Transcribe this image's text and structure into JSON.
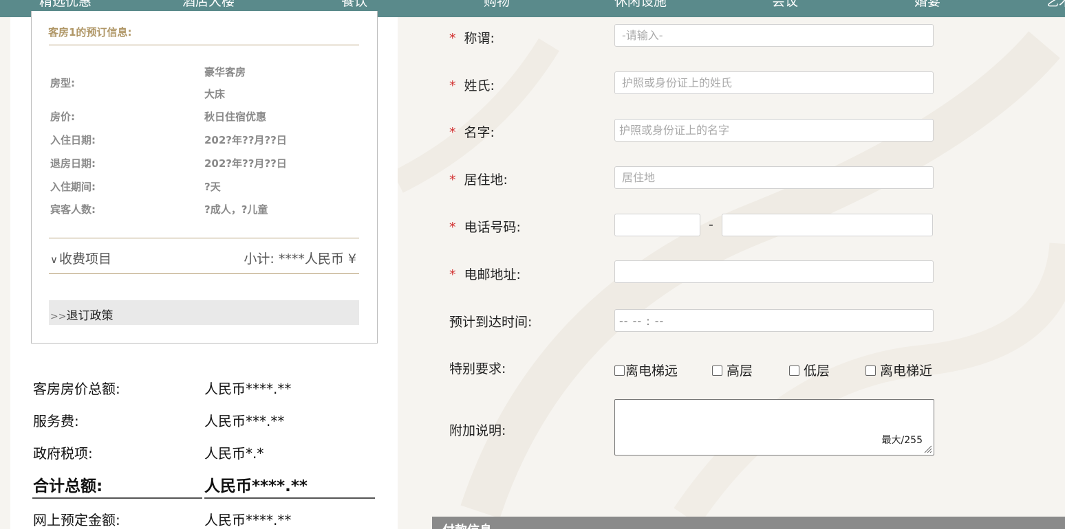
{
  "nav": {
    "items": [
      "精选优惠",
      "酒店大楼",
      "餐饮",
      "购物",
      "休闲设施",
      "会议",
      "婚宴",
      "艺术"
    ]
  },
  "booking": {
    "room_title": "客房1的预订信息:",
    "labels": {
      "room_type": "房型:",
      "room_price": "房价:",
      "checkin": "入住日期:",
      "checkout": "退房日期:",
      "stay": "入住期间:",
      "guests": "宾客人数:"
    },
    "values": {
      "room_type_1": "豪华客房",
      "room_type_2": "大床",
      "room_price": "秋日住宿优惠",
      "checkin": "202?年??月??日",
      "checkout": "202?年??月??日",
      "stay": "?天",
      "guests": "?成人，?儿童"
    },
    "fee_items": "收费项目",
    "subtotal": "小计: ****人民币 ¥",
    "policy_arrows": ">>",
    "policy": "退订政策"
  },
  "summary": {
    "room_total_label": "客房房价总额:",
    "room_total_value": "人民币****.**",
    "service_label": "服务费:",
    "service_value": "人民币***.**",
    "tax_label": "政府税项:",
    "tax_value": "人民币*.*",
    "grand_label": "合计总额:",
    "grand_value": "人民币****.**",
    "deposit_label": "网上预定金额:",
    "deposit_value": "人民币****.**"
  },
  "form": {
    "required_mark": "*",
    "title_label": "称谓:",
    "title_placeholder": "-请输入-",
    "surname_label": "姓氏:",
    "surname_placeholder": "护照或身份证上的姓氏",
    "given_label": "名字:",
    "given_placeholder": "护照或身份证上的名字",
    "residence_label": "居住地:",
    "residence_placeholder": "居住地",
    "phone_label": "电话号码:",
    "phone_dash": "-",
    "email_label": "电邮地址:",
    "arrival_label": "预计到达时间:",
    "arrival_value": "-- -- : --",
    "special_label": "特别要求:",
    "special_options": [
      "离电梯远",
      "高层",
      "低层",
      "离电梯近"
    ],
    "notes_label": "附加说明:",
    "notes_counter": "最大/255"
  },
  "payment": {
    "title": "付款信息"
  }
}
